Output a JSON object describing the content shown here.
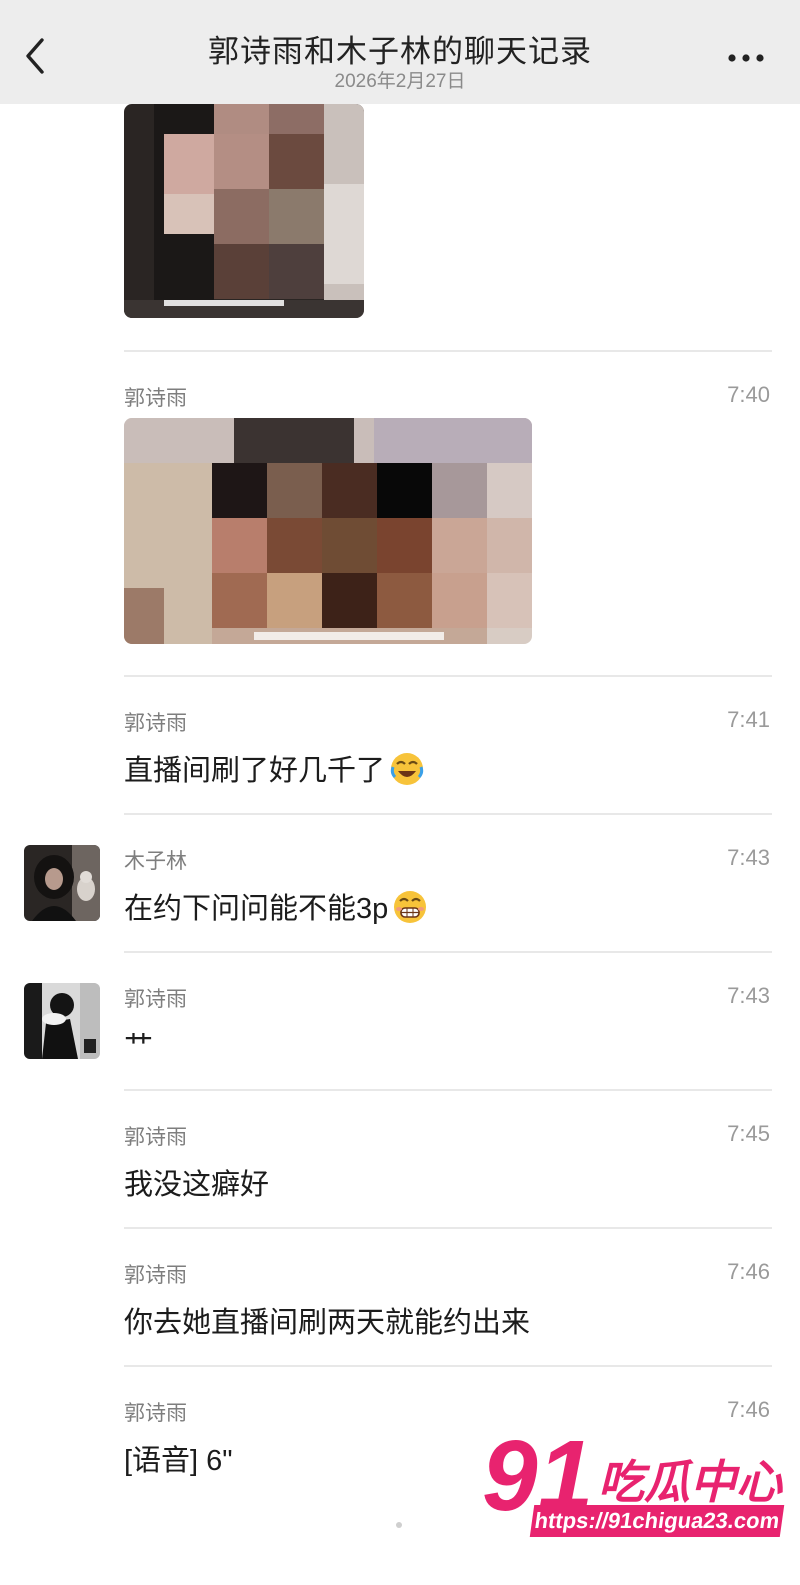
{
  "header": {
    "title": "郭诗雨和木子林的聊天记录",
    "date": "2026年2月27日"
  },
  "messages": [
    {
      "sender": "郭诗雨",
      "time": "7:40",
      "type": "image"
    },
    {
      "sender": "郭诗雨",
      "time": "7:41",
      "text": "直播间刷了好几千了",
      "emoji": "crying-laughing-emoji"
    },
    {
      "sender": "木子林",
      "time": "7:43",
      "text": "在约下问问能不能3p",
      "emoji": "grimacing-emoji"
    },
    {
      "sender": "郭诗雨",
      "time": "7:43",
      "text": "艹"
    },
    {
      "sender": "郭诗雨",
      "time": "7:45",
      "text": "我没这癖好"
    },
    {
      "sender": "郭诗雨",
      "time": "7:46",
      "text": "你去她直播间刷两天就能约出来"
    },
    {
      "sender": "郭诗雨",
      "time": "7:46",
      "text": "[语音] 6\""
    }
  ],
  "watermark": {
    "brand_number": "91",
    "brand_text": "吃瓜中心",
    "url": "https://91chigua23.com"
  },
  "colors": {
    "header_bg": "#ededed",
    "watermark_pink": "#e8236f"
  }
}
